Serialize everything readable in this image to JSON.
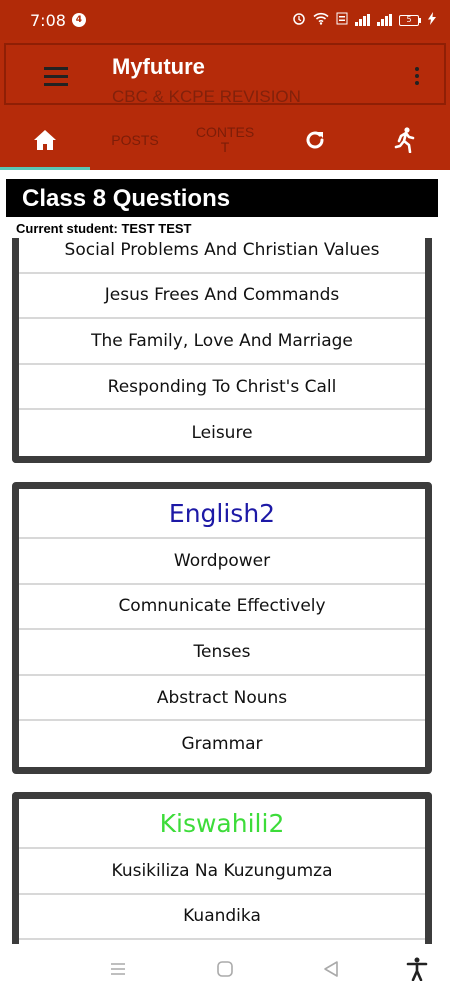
{
  "status_bar": {
    "time": "7:08",
    "notification_count": "4",
    "battery_level": "5"
  },
  "app_bar": {
    "title": "Myfuture",
    "subtitle": "CBC & KCPE REVISION"
  },
  "tabs": [
    {
      "label": "",
      "icon": "home-icon",
      "active": true
    },
    {
      "label": "POSTS",
      "icon": "",
      "active": false
    },
    {
      "label": "CONTEST",
      "icon": "",
      "active": false
    },
    {
      "label": "",
      "icon": "refresh-icon",
      "active": false
    },
    {
      "label": "",
      "icon": "running-person-icon",
      "active": false
    }
  ],
  "page": {
    "heading": "Class 8 Questions",
    "current_student": "Current student: TEST TEST"
  },
  "cards": [
    {
      "title": "",
      "title_color": "",
      "items": [
        "Social Problems And Christian  Values",
        "Jesus Frees And  Commands",
        "The Family, Love And  Marriage",
        "Responding To Christ's  Call",
        "Leisure"
      ]
    },
    {
      "title": "English2",
      "title_color": "#1d19a6",
      "items": [
        "Wordpower",
        "Comnunicate  Effectively",
        "Tenses",
        "Abstract Nouns",
        "Grammar"
      ]
    },
    {
      "title": "Kiswahili2",
      "title_color": "#3ddc3a",
      "items": [
        "Kusikiliza Na  Kuzungumza",
        "Kuandika",
        ""
      ]
    }
  ],
  "colors": {
    "app_bar": "#b52b0a",
    "tab_indicator": "#5ac7b5",
    "card_border": "#3c3c3c"
  },
  "nav_bar": {
    "icons": [
      "recent-apps-icon",
      "home-circle-icon",
      "back-icon",
      "accessibility-icon"
    ]
  }
}
